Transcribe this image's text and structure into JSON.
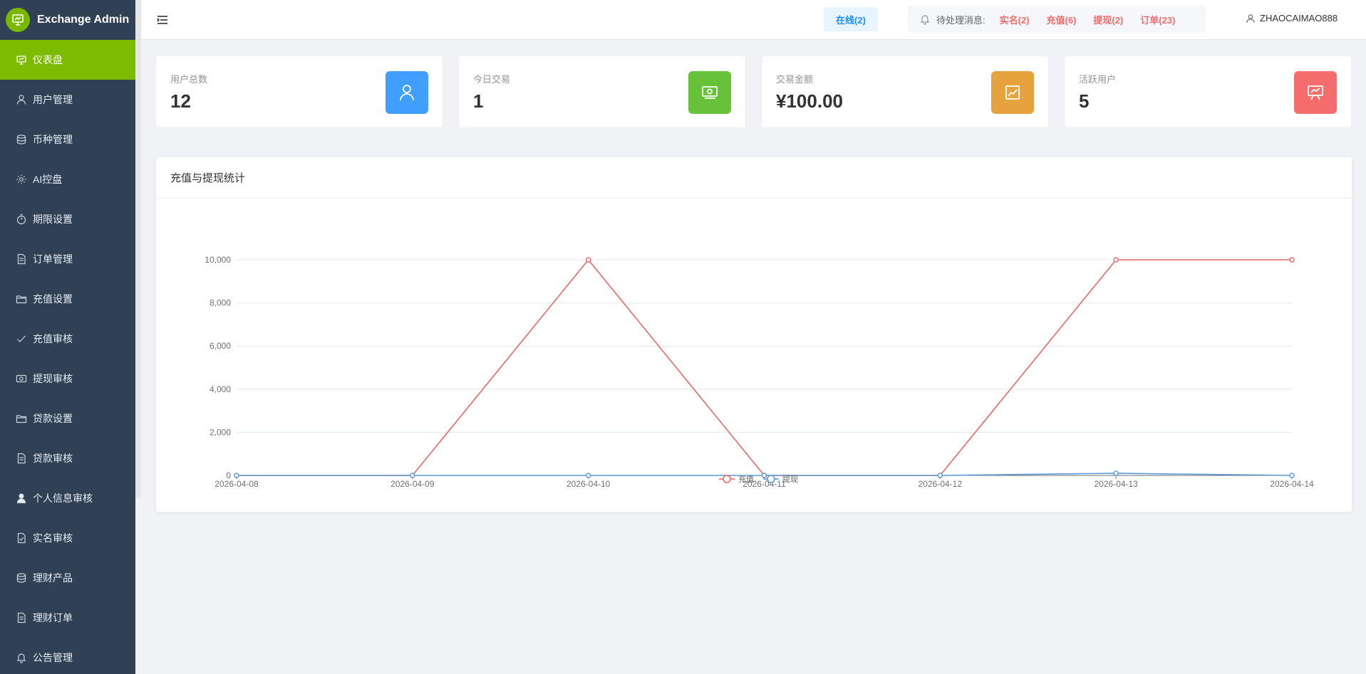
{
  "brand": {
    "title": "Exchange Admin"
  },
  "sidebar": {
    "items": [
      {
        "label": "仪表盘",
        "icon": "dashboard-icon",
        "active": true
      },
      {
        "label": "用户管理",
        "icon": "user-icon"
      },
      {
        "label": "币种管理",
        "icon": "database-icon"
      },
      {
        "label": "AI控盘",
        "icon": "gear-icon"
      },
      {
        "label": "期限设置",
        "icon": "timer-icon"
      },
      {
        "label": "订单管理",
        "icon": "document-icon"
      },
      {
        "label": "充值设置",
        "icon": "folder-icon"
      },
      {
        "label": "充值审核",
        "icon": "check-icon"
      },
      {
        "label": "提现审核",
        "icon": "money-icon"
      },
      {
        "label": "贷款设置",
        "icon": "folder-icon"
      },
      {
        "label": "贷款审核",
        "icon": "document-icon"
      },
      {
        "label": "个人信息审核",
        "icon": "person-icon"
      },
      {
        "label": "实名审核",
        "icon": "document-check-icon"
      },
      {
        "label": "理财产品",
        "icon": "database-icon"
      },
      {
        "label": "理财订单",
        "icon": "document-icon"
      },
      {
        "label": "公告管理",
        "icon": "bell-icon"
      }
    ]
  },
  "header": {
    "online": "在线(2)",
    "pending_label": "待处理消息:",
    "pending": [
      {
        "label": "实名(2)"
      },
      {
        "label": "充值(6)"
      },
      {
        "label": "提现(2)"
      },
      {
        "label": "订单(23)"
      }
    ],
    "username": "ZHAOCAIMAO888"
  },
  "stats": [
    {
      "label": "用户总数",
      "value": "12",
      "color": "#409eff",
      "icon": "user-icon"
    },
    {
      "label": "今日交易",
      "value": "1",
      "color": "#67c23a",
      "icon": "money-icon"
    },
    {
      "label": "交易金额",
      "value": "¥100.00",
      "color": "#e6a23c",
      "icon": "trend-chart-icon"
    },
    {
      "label": "活跃用户",
      "value": "5",
      "color": "#f56c6c",
      "icon": "presentation-icon"
    }
  ],
  "chart_panel": {
    "title": "充值与提现统计"
  },
  "chart_data": {
    "type": "line",
    "x": [
      "2026-04-08",
      "2026-04-09",
      "2026-04-10",
      "2026-04-11",
      "2026-04-12",
      "2026-04-13",
      "2026-04-14"
    ],
    "series": [
      {
        "name": "充值",
        "color": "#ee6666",
        "values": [
          0,
          0,
          10000,
          0,
          0,
          10000,
          10000
        ]
      },
      {
        "name": "提现",
        "color": "#5b9bd5",
        "values": [
          0,
          0,
          0,
          0,
          0,
          100,
          0
        ]
      }
    ],
    "y_ticks": [
      "0",
      "2,000",
      "4,000",
      "6,000",
      "8,000",
      "10,000"
    ],
    "ylim": [
      0,
      10000
    ],
    "grid": true,
    "legend": "bottom-center"
  }
}
